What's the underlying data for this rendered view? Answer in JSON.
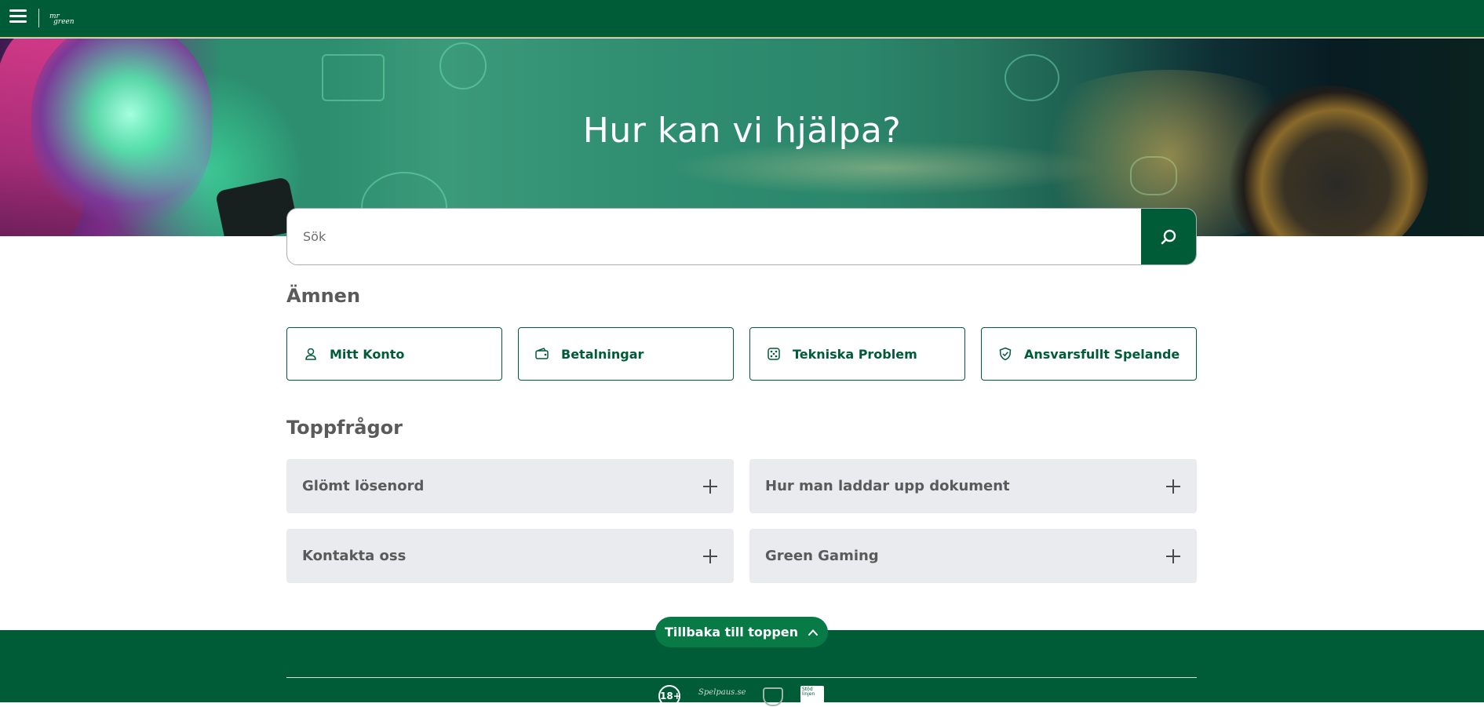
{
  "topbar": {
    "menu_icon": "hamburger-menu-icon",
    "logo_line1": "mr",
    "logo_line2": "green"
  },
  "hero": {
    "title": "Hur kan vi hjälpa?"
  },
  "search": {
    "placeholder": "Sök",
    "icon": "search-icon"
  },
  "topics": {
    "heading": "Ämnen",
    "items": [
      {
        "label": "Mitt Konto",
        "icon": "user-icon"
      },
      {
        "label": "Betalningar",
        "icon": "wallet-icon"
      },
      {
        "label": "Tekniska Problem",
        "icon": "dice-icon"
      },
      {
        "label": "Ansvarsfullt Spelande",
        "icon": "shield-check-icon"
      }
    ]
  },
  "faq": {
    "heading": "Toppfrågor",
    "items": [
      {
        "question": "Glömt lösenord"
      },
      {
        "question": "Hur man laddar upp dokument"
      },
      {
        "question": "Kontakta oss"
      },
      {
        "question": "Green Gaming"
      }
    ]
  },
  "footer": {
    "back_to_top": "Tillbaka till toppen",
    "age_badge": "18+",
    "spelpaus": "Spelpaus.se",
    "stodlinjen": "Stöd linjen"
  },
  "colors": {
    "brand_green": "#005b37",
    "button_green": "#087a46",
    "faq_bg": "#e9ebee"
  }
}
